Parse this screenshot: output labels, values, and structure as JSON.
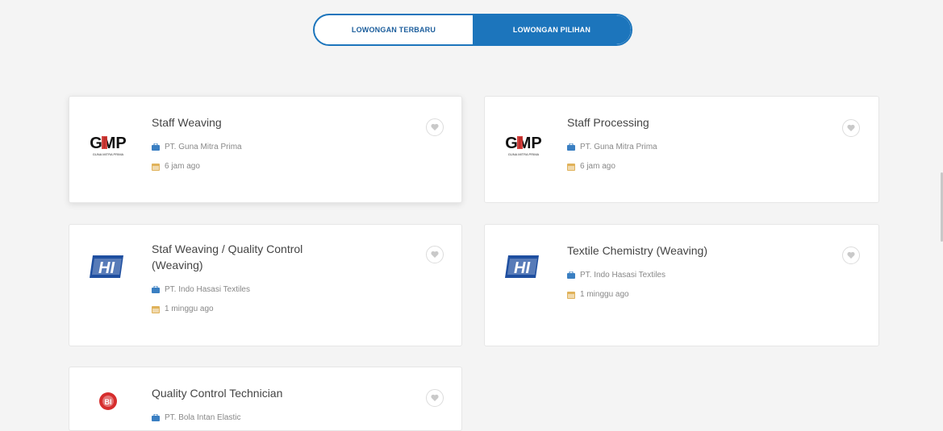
{
  "tabs": [
    {
      "label": "LOWONGAN TERBARU"
    },
    {
      "label": "LOWONGAN PILIHAN"
    }
  ],
  "jobs": [
    {
      "title_line1": "Staff Weaving",
      "title_line2": "",
      "company": "PT. Guna Mitra Prima",
      "posted": "6 jam ago",
      "logo": "gmp-logo",
      "logo_text": "GMP",
      "logo_sub": "GUNA MITRA PRIMA"
    },
    {
      "title_line1": "Staff Processing",
      "title_line2": "",
      "company": "PT. Guna Mitra Prima",
      "posted": "6 jam ago",
      "logo": "gmp-logo",
      "logo_text": "GMP",
      "logo_sub": "GUNA MITRA PRIMA"
    },
    {
      "title_line1": "Staf Weaving / Quality Control",
      "title_line2": "(Weaving)",
      "company": "PT. Indo Hasasi Textiles",
      "posted": "1 minggu ago",
      "logo": "hi-logo",
      "logo_text": "HI",
      "logo_sub": ""
    },
    {
      "title_line1": "Textile Chemistry (Weaving)",
      "title_line2": "",
      "company": "PT. Indo Hasasi Textiles",
      "posted": "1 minggu ago",
      "logo": "hi-logo",
      "logo_text": "HI",
      "logo_sub": ""
    },
    {
      "title_line1": "Quality Control Technician",
      "title_line2": "",
      "company": "PT. Bola Intan Elastic",
      "posted": "",
      "logo": "bi-logo",
      "logo_text": "BI",
      "logo_sub": ""
    }
  ],
  "icons": {
    "company": "briefcase-icon",
    "posted": "calendar-icon",
    "favorite": "heart-icon"
  },
  "colors": {
    "primary": "#1c75bc",
    "heart": "#c9c9c9",
    "meta_icon": "#3a7fc2",
    "calendar_icon": "#e0b25a",
    "bi_red": "#d62d2d"
  }
}
